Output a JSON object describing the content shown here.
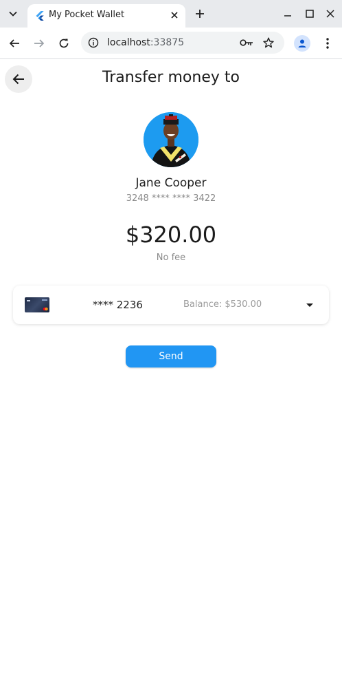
{
  "browser": {
    "tab_title": "My Pocket Wallet",
    "url_host": "localhost",
    "url_port": ":33875",
    "icons": [
      "tab-search-icon",
      "flutter-favicon-icon",
      "close-icon",
      "plus-icon",
      "minimize-icon",
      "maximize-icon",
      "close-window-icon",
      "back-arrow-icon",
      "forward-arrow-icon",
      "reload-icon",
      "info-icon",
      "key-icon",
      "star-icon",
      "profile-icon",
      "more-vert-icon"
    ]
  },
  "page": {
    "title": "Transfer money to",
    "back_icon": "arrow-back-icon"
  },
  "recipient": {
    "name": "Jane Cooper",
    "card_masked": "3248 **** **** 3422",
    "avatar_bg": "#1d9bf0"
  },
  "transfer": {
    "amount": "$320.00",
    "fee_text": "No fee"
  },
  "source_card": {
    "number_masked": "**** 2236",
    "balance_text": "Balance: $530.00",
    "dropdown_icon": "arrow-drop-down-icon"
  },
  "actions": {
    "send_label": "Send",
    "accent": "#2196f3"
  }
}
